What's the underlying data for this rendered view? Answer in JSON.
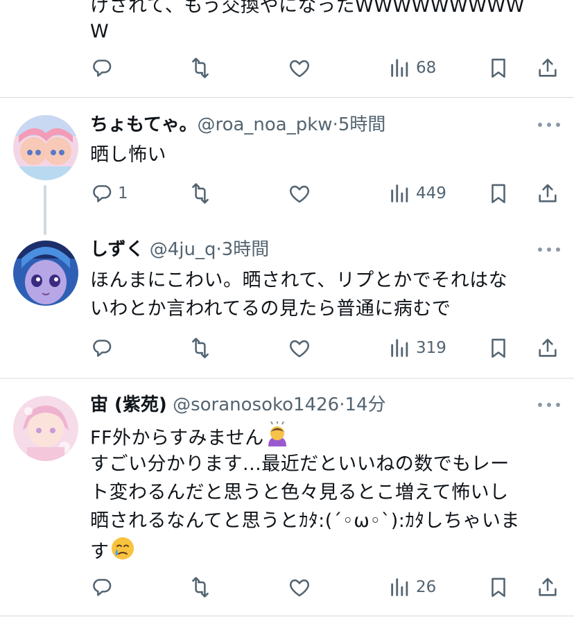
{
  "colors": {
    "text": "#0f1419",
    "secondary": "#536471",
    "divider": "#d6dadd",
    "icon": "#536471"
  },
  "icons": [
    "reply-icon",
    "retweet-icon",
    "like-icon",
    "views-icon",
    "bookmark-icon",
    "share-icon",
    "more-icon"
  ],
  "top_fragment": {
    "line1": "けされて、もう交換やになったWWWWWWWWW",
    "line2": "W",
    "views": "68"
  },
  "tweets": [
    {
      "name": "ちょもてゃ。",
      "handle": "@roa_noa_pkw",
      "dot": "·",
      "time": "5時間",
      "lines": [
        "晒し怖い"
      ],
      "replies": "1",
      "views": "449"
    },
    {
      "name": "しずく",
      "handle": "@4ju_q",
      "dot": "·",
      "time": "3時間",
      "lines": [
        "ほんまにこわい。晒されて、リプとかでそれはな",
        "いわとか言われてるの見たら普通に病むで"
      ],
      "views": "319"
    },
    {
      "name": "宙 (紫苑)",
      "handle": "@soranosoko1426",
      "dot": "·",
      "time": "14分",
      "lines": [
        "FF外からすみません",
        "すごい分かります...最近だといいねの数でもレー",
        "ト変わるんだと思うと色々見るとこ増えて怖いし",
        "晒されるなんてと思うとｶﾀ:(´◦ω◦`):ｶﾀしちゃいま",
        "す"
      ],
      "views": "26"
    }
  ]
}
